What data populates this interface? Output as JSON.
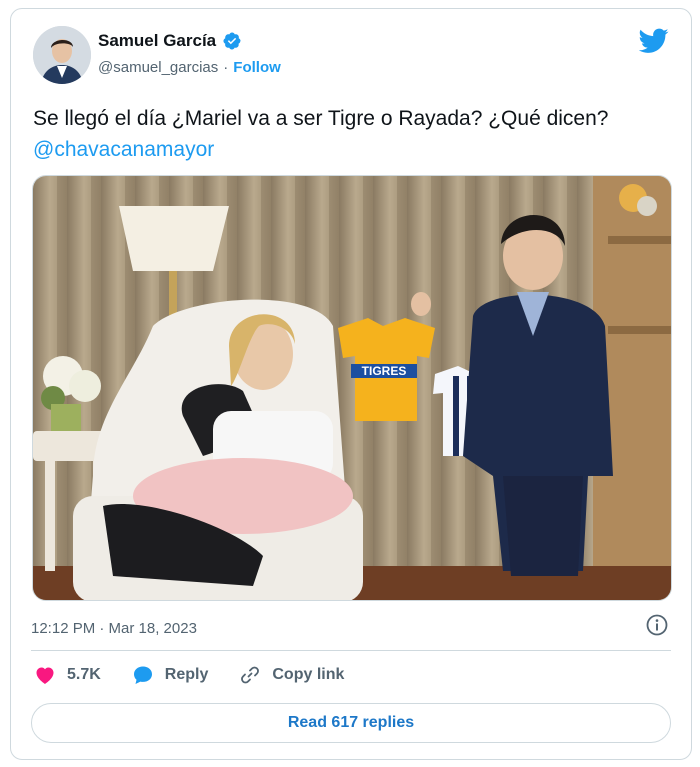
{
  "author": {
    "name": "Samuel García",
    "handle": "@samuel_garcias",
    "separator": "·",
    "follow_label": "Follow"
  },
  "tweet": {
    "text": "Se llegó el día ¿Mariel va a ser Tigre o Rayada? ¿Qué dicen? ",
    "mention": "@chavacanamayor",
    "media": {
      "jersey_text": "TIGRES"
    }
  },
  "meta": {
    "timestamp": "12:12 PM · Mar 18, 2023"
  },
  "actions": {
    "likes": "5.7K",
    "reply_label": "Reply",
    "copy_link_label": "Copy link"
  },
  "read_replies_label": "Read 617 replies",
  "colors": {
    "accent": "#1d9bf0",
    "like": "#f91880",
    "secondary_text": "#536471",
    "border": "#cfd9de"
  },
  "icons": [
    "verified-badge-icon",
    "twitter-bird-icon",
    "info-icon",
    "heart-icon",
    "reply-bubble-icon",
    "link-icon"
  ]
}
